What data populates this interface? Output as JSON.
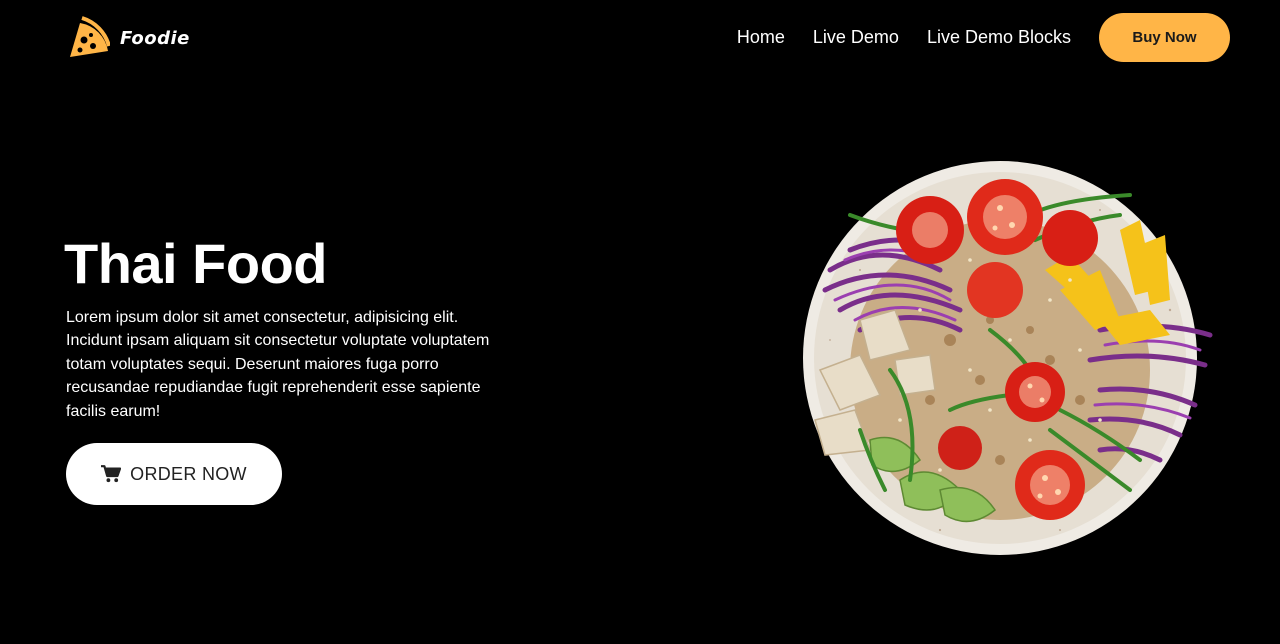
{
  "brand": {
    "name": "Foodie",
    "accent_color": "#ffb547",
    "logo_icon": "pizza-slice-icon"
  },
  "nav": {
    "items": [
      {
        "label": "Home"
      },
      {
        "label": "Live Demo"
      },
      {
        "label": "Live Demo Blocks"
      }
    ],
    "buy_label": "Buy Now"
  },
  "hero": {
    "title": "Thai Food",
    "description": "Lorem ipsum dolor sit amet consectetur, adipisicing elit. Incidunt ipsam aliquam sit consectetur voluptate voluptatem totam voluptates sequi. Deserunt maiores fuga porro recusandae repudiandae fugit reprehenderit esse sapiente facilis earum!",
    "order_label": "ORDER NOW",
    "order_icon": "cart-icon",
    "image_subject": "salad-bowl-image"
  },
  "colors": {
    "background": "#000000",
    "text": "#ffffff",
    "button_bg": "#ffffff"
  }
}
